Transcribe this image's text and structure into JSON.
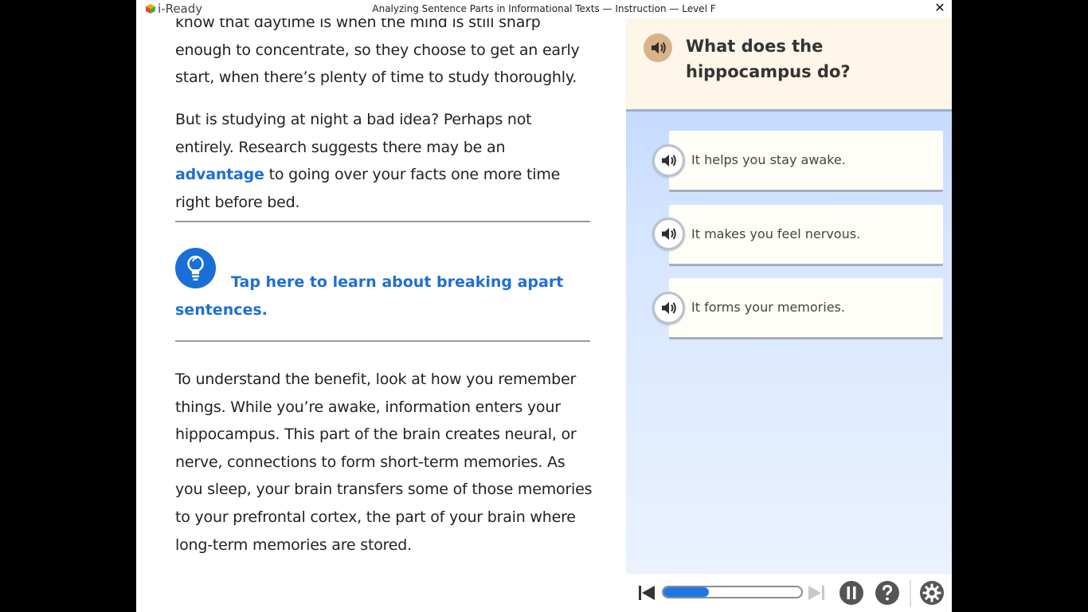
{
  "app": {
    "brand": "i-Ready",
    "window_title": "Analyzing Sentence Parts in Informational Texts — Instruction — Level F",
    "close_label": "✕"
  },
  "reading": {
    "para1": "know that daytime is when the mind is still sharp enough to concentrate, so they choose to get an early start, when there’s plenty of time to study thoroughly.",
    "para2_before": "But is studying at night a bad idea? Perhaps not entirely. Research suggests there may be an ",
    "para2_link": "advantage",
    "para2_after": " to going over your facts one more time right before bed.",
    "tip_text": "Tap here to learn about breaking apart sentences.",
    "para3": "To understand the benefit, look at how you remember things. While you’re awake, information enters your hippocampus. This part of the brain creates neural, or nerve, connections to form short-term memories. As you sleep, your brain transfers some of those memories to your prefrontal cortex, the part of your brain where long-term memories are stored."
  },
  "question": {
    "text": "What does the hippocampus do?",
    "answers": [
      {
        "label": "It helps you stay awake."
      },
      {
        "label": "It makes you feel nervous."
      },
      {
        "label": "It forms your memories."
      }
    ]
  },
  "controls": {
    "progress": 0.33
  },
  "colors": {
    "link": "#1f6fd1",
    "tip_icon": "#1a6fd6",
    "progress": "#1d78e6",
    "question_header": "#fdf6e9",
    "audio_accent": "#d9b48a"
  },
  "icons": {
    "brand": "cube-logo-icon",
    "close": "close-icon",
    "tip": "lightbulb-icon",
    "audio": "speaker-icon",
    "skip_back": "skip-back-icon",
    "skip_forward": "skip-forward-icon",
    "pause": "pause-icon",
    "help": "help-icon",
    "settings": "gear-icon"
  }
}
